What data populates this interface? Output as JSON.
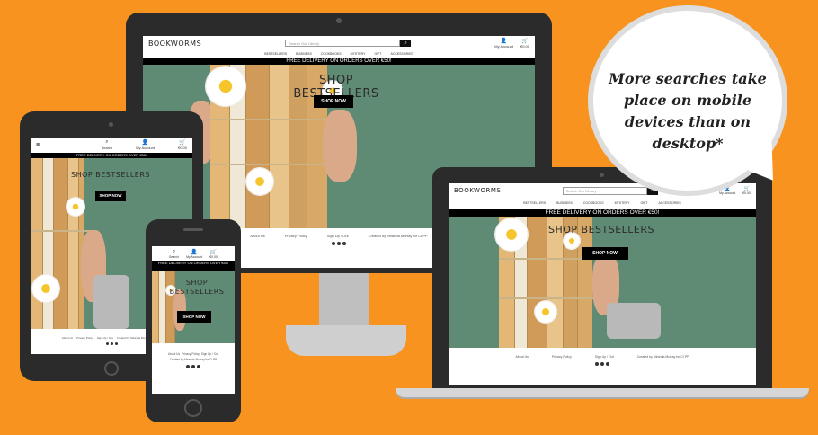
{
  "brand": "BOOKWORMS",
  "search_placeholder": "Search Our Library",
  "account": {
    "label": "My Account",
    "search_label": "Search",
    "cart_label": "€0.00"
  },
  "categories": [
    "BESTSELLERS",
    "BUSINESS",
    "COOKBOOKS",
    "MYSTERY",
    "GIFT",
    "ACCESSORIES"
  ],
  "banner": "FREE DELIVERY ON ORDERS OVER €50!",
  "hero": {
    "title": "SHOP BESTSELLERS",
    "title_line1": "SHOP",
    "title_line2": "BESTSELLERS",
    "button": "SHOP NOW"
  },
  "footer": {
    "about": "About Us",
    "privacy": "Privacy Policy",
    "order": "Sign Up / Out",
    "credit": "Created by Miranda Murray for CI PP"
  },
  "callout": "More searches take place on mobile devices than on desktop*",
  "colors": {
    "background": "#f7931e",
    "hero": "#5f8a73",
    "device": "#2b2b2b"
  }
}
